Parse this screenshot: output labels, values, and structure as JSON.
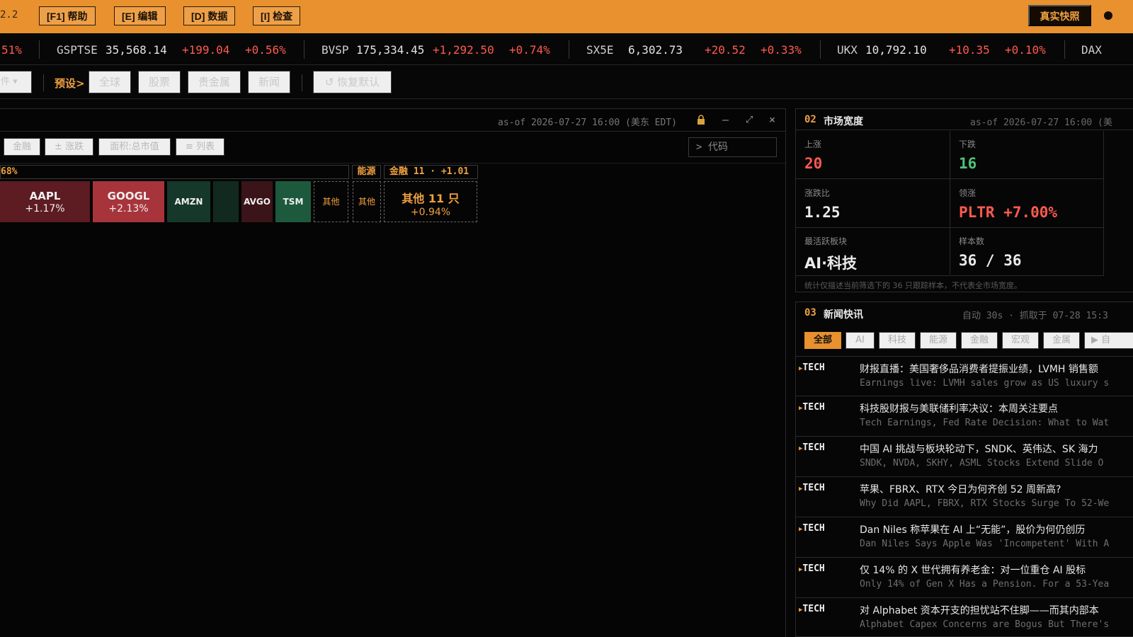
{
  "topbar": {
    "version_fragment": "2.2",
    "keys": [
      {
        "label": "[F1] 帮助"
      },
      {
        "label": "[E] 编辑"
      },
      {
        "label": "[D] 数据"
      },
      {
        "label": "[I] 检查"
      }
    ],
    "snapshot_label": "真实快照"
  },
  "ticker": [
    {
      "change_pct": "51%"
    },
    {
      "symbol": "GSPTSE",
      "value": "35,568.14",
      "change": "+199.04",
      "change_pct": "+0.56%"
    },
    {
      "symbol": "BVSP",
      "value": "175,334.45",
      "change": "+1,292.50",
      "change_pct": "+0.74%"
    },
    {
      "symbol": "SX5E",
      "value": "6,302.73",
      "change": "+20.52",
      "change_pct": "+0.33%"
    },
    {
      "symbol": "UKX",
      "value": "10,792.10",
      "change": "+10.35",
      "change_pct": "+0.10%"
    },
    {
      "symbol": "DAX"
    }
  ],
  "presets": {
    "filter_fragment": "件 ▾",
    "label": "预设>",
    "buttons": [
      "全球",
      "股票",
      "贵金属",
      "新闻"
    ],
    "reset": "↺ 恢复默认"
  },
  "left_panel": {
    "asof": "as-of 2026-07-27 16:00 (美东 EDT)",
    "tools": [
      "金融",
      "± 涨跌",
      "面积:总市值",
      "≡ 列表"
    ],
    "code_placeholder": "> 代码",
    "groups": [
      {
        "header": "68%"
      },
      {
        "header": "能源"
      },
      {
        "header": "金融 11 · +1.01"
      }
    ],
    "cells": [
      {
        "symbol": "AAPL",
        "change": "+1.17%"
      },
      {
        "symbol": "GOOGL",
        "change": "+2.13%"
      },
      {
        "symbol": "AMZN"
      },
      {
        "symbol": ""
      },
      {
        "symbol": "AVGO"
      },
      {
        "symbol": "TSM"
      },
      {
        "symbol": "其他"
      },
      {
        "symbol": "其他"
      },
      {
        "symbol": "其他 11 只",
        "change": "+0.94%"
      }
    ],
    "colors": {
      "up_strong": "#a8343b",
      "up_mid": "#5c1c22",
      "up_dark": "#3a1418",
      "down_dark": "#15382a",
      "down_mid": "#1d5a3d"
    }
  },
  "breadth": {
    "num": "02",
    "title": "市场宽度",
    "asof": "as-of 2026-07-27 16:00 (美",
    "stats": [
      {
        "label": "上涨",
        "value": "20"
      },
      {
        "label": "下跌",
        "value": "16"
      },
      {
        "label": "涨跌比",
        "value": "1.25"
      },
      {
        "label": "领涨",
        "value": "PLTR +7.00%"
      },
      {
        "label": "最活跃板块",
        "value": "AI·科技"
      },
      {
        "label": "样本数",
        "value": "36 / 36"
      }
    ],
    "footnote": "统计仅描述当前筛选下的 36 只跟踪样本，不代表全市场宽度。"
  },
  "news": {
    "num": "03",
    "title": "新闻快讯",
    "meta": "自动 30s · 抓取于 07-28 15:3",
    "filters": [
      "全部",
      "AI",
      "科技",
      "能源",
      "金融",
      "宏观",
      "金属",
      "▶ 自"
    ],
    "items": [
      {
        "tag": "TECH",
        "zh": "财报直播：美国奢侈品消费者提振业绩，LVMH 销售额",
        "en": "Earnings live: LVMH sales grow as US luxury s"
      },
      {
        "tag": "TECH",
        "zh": "科技股财报与美联储利率决议：本周关注要点",
        "en": "Tech Earnings, Fed Rate Decision: What to Wat"
      },
      {
        "tag": "TECH",
        "zh": "中国 AI 挑战与板块轮动下，SNDK、英伟达、SK 海力",
        "en": "SNDK, NVDA, SKHY, ASML Stocks Extend Slide O"
      },
      {
        "tag": "TECH",
        "zh": "苹果、FBRX、RTX 今日为何齐创 52 周新高?",
        "en": "Why Did AAPL, FBRX, RTX Stocks Surge To 52-We"
      },
      {
        "tag": "TECH",
        "zh": "Dan Niles 称苹果在 AI 上“无能”，股价为何仍创历",
        "en": "Dan Niles Says Apple Was 'Incompetent' With A"
      },
      {
        "tag": "TECH",
        "zh": "仅 14% 的 X 世代拥有养老金：对一位重仓 AI 股标",
        "en": "Only 14% of Gen X Has a Pension. For a 53-Yea"
      },
      {
        "tag": "TECH",
        "zh": "对 Alphabet 资本开支的担忧站不住脚——而其内部本",
        "en": "Alphabet Capex Concerns are Bogus But There's"
      }
    ]
  }
}
